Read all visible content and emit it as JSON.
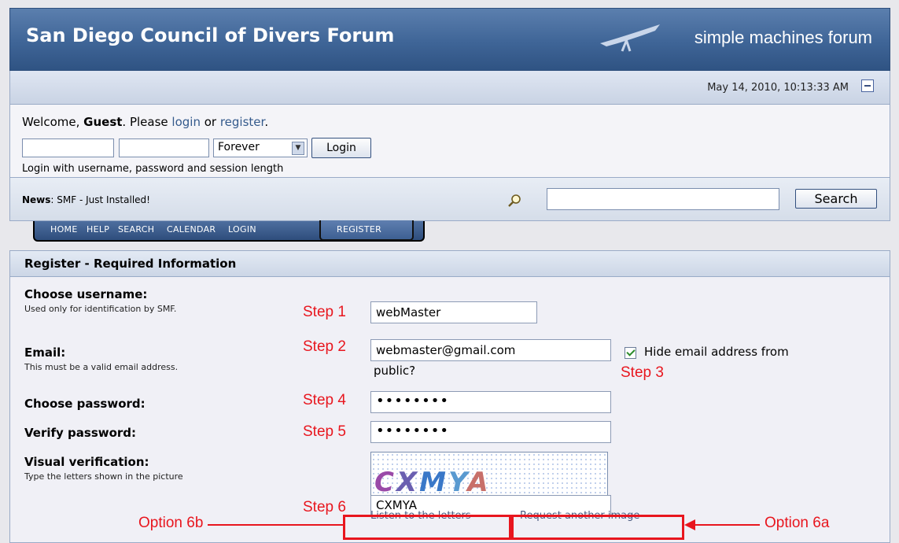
{
  "header": {
    "title": "San Diego Council of Divers Forum",
    "brand": "simple machines forum"
  },
  "datebar": {
    "date": "May 14, 2010, 10:13:33 AM"
  },
  "userbox": {
    "welcome_prefix": "Welcome, ",
    "guest": "Guest",
    "please": ". Please ",
    "login_link": "login",
    "or": " or ",
    "register_link": "register",
    "period": ".",
    "session_value": "Forever",
    "login_button": "Login",
    "hint": "Login with username, password and session length"
  },
  "news": {
    "label": "News",
    "text": ": SMF - Just Installed!",
    "search_button": "Search"
  },
  "menu": {
    "items": [
      "HOME",
      "HELP",
      "SEARCH",
      "CALENDAR",
      "LOGIN",
      "REGISTER"
    ]
  },
  "register": {
    "title": "Register - Required Information",
    "username_label": "Choose username:",
    "username_sub": "Used only for identification by SMF.",
    "username_value": "webMaster",
    "email_label": "Email:",
    "email_sub": "This must be a valid email address.",
    "email_value": "webmaster@gmail.com",
    "hide_email_label": "Hide email address from",
    "hide_email_label_2": "public?",
    "password_label": "Choose password:",
    "password_value": "••••••••",
    "verify_label": "Verify password:",
    "verify_value": "••••••••",
    "visual_label": "Visual verification:",
    "visual_sub": "Type the letters shown in the picture",
    "captcha_text": "CXMYA",
    "captcha_value": "CXMYA",
    "listen_link": "Listen to the letters",
    "request_link": "Request another image"
  },
  "annotations": {
    "step1": "Step 1",
    "step2": "Step 2",
    "step3": "Step 3",
    "step4": "Step 4",
    "step5": "Step 5",
    "step6": "Step 6",
    "option6b": "Option 6b",
    "option6a": "Option 6a",
    "color": "#e8161e"
  }
}
